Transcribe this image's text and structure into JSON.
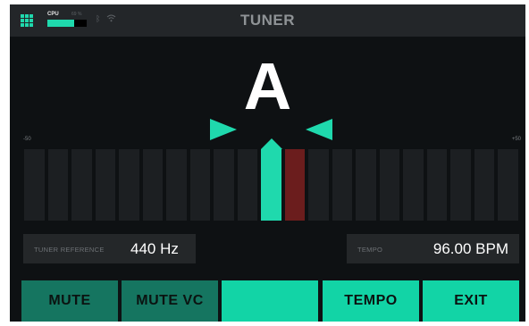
{
  "top_bar": {
    "title": "TUNER",
    "cpu_label": "CPU",
    "cpu_percent_text": "69 %",
    "cpu_fill_fraction": 0.69,
    "icons": [
      "menu-grid-icon",
      "bluetooth-icon",
      "wifi-icon"
    ]
  },
  "tuner": {
    "note": "A",
    "scale_min": "-50",
    "scale_max": "+50",
    "segment_count": 21,
    "center_segment_index": 10,
    "offset_segment_index": 11
  },
  "fields": {
    "reference_label": "TUNER REFERENCE",
    "reference_value": "440 Hz",
    "tempo_label": "TEMPO",
    "tempo_value": "96.00 BPM"
  },
  "buttons": [
    {
      "label": "MUTE",
      "style": "dark"
    },
    {
      "label": "MUTE VC",
      "style": "dark"
    },
    {
      "label": "",
      "style": "light"
    },
    {
      "label": "TEMPO",
      "style": "light"
    },
    {
      "label": "EXIT",
      "style": "light"
    }
  ],
  "colors": {
    "accent": "#1fd9ad",
    "accent_dark": "#157560",
    "offset": "#6b1d1d",
    "background": "#0e1113",
    "panel": "#242729"
  }
}
